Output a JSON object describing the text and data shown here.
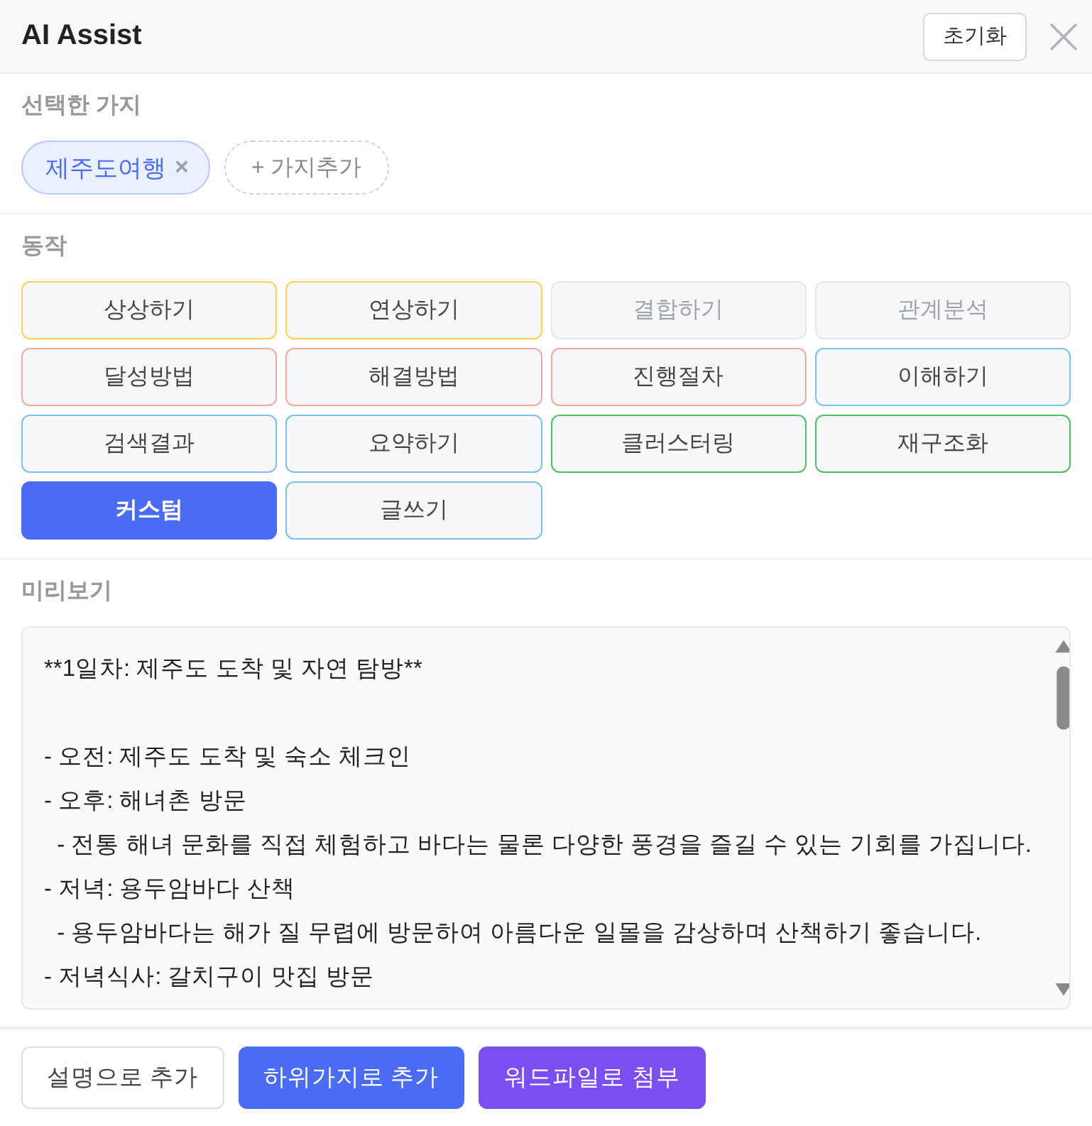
{
  "header": {
    "title": "AI Assist",
    "reset_button": "초기화"
  },
  "selected_branches": {
    "label": "선택한 가지",
    "chips": [
      {
        "text": "제주도여행",
        "remove": "×"
      }
    ],
    "add_button": "+ 가지추가"
  },
  "actions": {
    "label": "동작",
    "buttons": [
      {
        "label": "상상하기",
        "color": "#fcd34d",
        "disabled": false,
        "selected": false
      },
      {
        "label": "연상하기",
        "color": "#fcd34d",
        "disabled": false,
        "selected": false
      },
      {
        "label": "결합하기",
        "color": "#e5e7eb",
        "disabled": true,
        "selected": false
      },
      {
        "label": "관계분석",
        "color": "#e5e7eb",
        "disabled": true,
        "selected": false
      },
      {
        "label": "달성방법",
        "color": "#fca5a5",
        "disabled": false,
        "selected": false
      },
      {
        "label": "해결방법",
        "color": "#fca5a5",
        "disabled": false,
        "selected": false
      },
      {
        "label": "진행절차",
        "color": "#fca5a5",
        "disabled": false,
        "selected": false
      },
      {
        "label": "이해하기",
        "color": "#7cc0f5",
        "disabled": false,
        "selected": false
      },
      {
        "label": "검색결과",
        "color": "#7cc0f5",
        "disabled": false,
        "selected": false
      },
      {
        "label": "요약하기",
        "color": "#7cc0f5",
        "disabled": false,
        "selected": false
      },
      {
        "label": "클러스터링",
        "color": "#4cc35a",
        "disabled": false,
        "selected": false
      },
      {
        "label": "재구조화",
        "color": "#4cc35a",
        "disabled": false,
        "selected": false
      },
      {
        "label": "커스텀",
        "color": "#4a6cf5",
        "disabled": false,
        "selected": true
      },
      {
        "label": "글쓰기",
        "color": "#7cc0f5",
        "disabled": false,
        "selected": false
      }
    ]
  },
  "preview": {
    "label": "미리보기",
    "heading": "**1일차: 제주도 도착 및 자연 탐방**",
    "lines": [
      "- 오전: 제주도 도착 및 숙소 체크인",
      "- 오후: 해녀촌 방문",
      "  - 전통 해녀 문화를 직접 체험하고 바다는 물론 다양한 풍경을 즐길 수 있는 기회를 가집니다.",
      "- 저녁: 용두암바다 산책",
      "  - 용두암바다는 해가 질 무렵에 방문하여 아름다운 일몰을 감상하며 산책하기 좋습니다.",
      "- 저녁식사: 갈치구이 맛집 방문"
    ]
  },
  "footer": {
    "buttons": [
      {
        "label": "설명으로 추가",
        "kind": "outline"
      },
      {
        "label": "하위가지로 추가",
        "kind": "primary"
      },
      {
        "label": "워드파일로 첨부",
        "kind": "purple"
      }
    ]
  }
}
